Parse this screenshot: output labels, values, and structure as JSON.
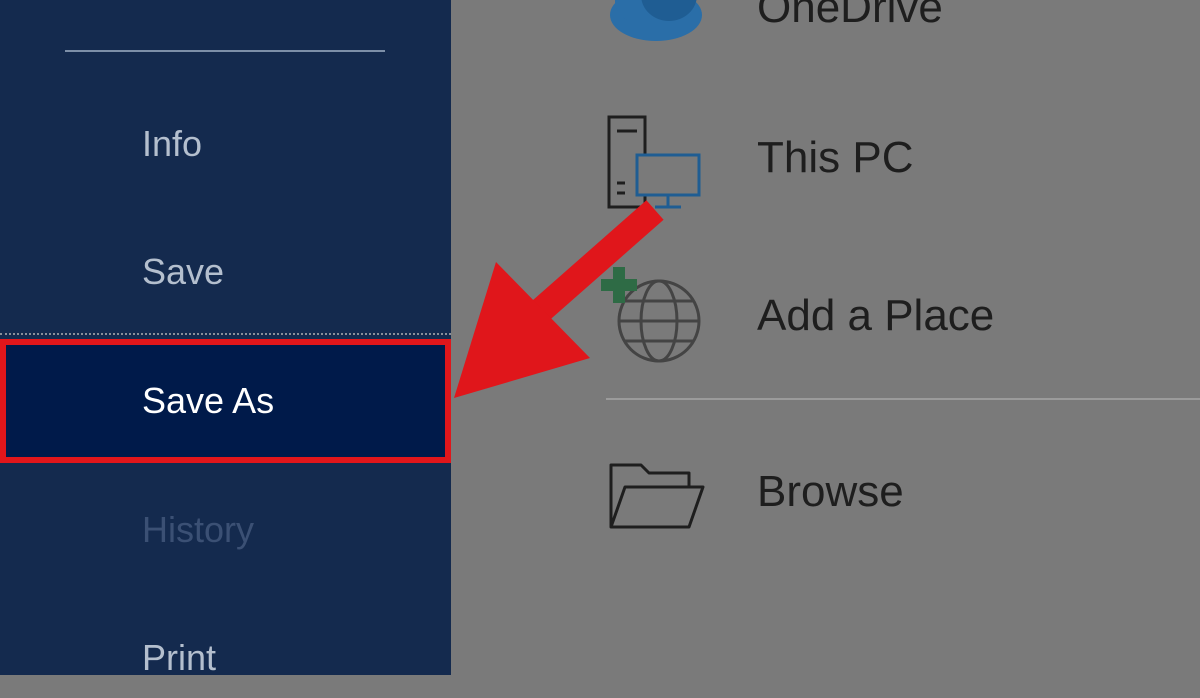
{
  "sidebar": {
    "items": [
      {
        "label": "Info",
        "state": "normal"
      },
      {
        "label": "Save",
        "state": "normal"
      },
      {
        "label": "Save As",
        "state": "selected"
      },
      {
        "label": "History",
        "state": "disabled"
      },
      {
        "label": "Print",
        "state": "normal"
      }
    ]
  },
  "locations": {
    "items": [
      {
        "label": "OneDrive",
        "icon": "onedrive-cloud-icon"
      },
      {
        "label": "This PC",
        "icon": "this-pc-icon"
      },
      {
        "label": "Add a Place",
        "icon": "add-place-globe-icon"
      },
      {
        "label": "Browse",
        "icon": "folder-open-icon"
      }
    ]
  },
  "annotation": {
    "arrow_color": "#e0161b",
    "highlight_color": "#e0161b"
  },
  "colors": {
    "sidebar_bg": "#142a4e",
    "selected_bg": "#001a4a",
    "content_bg": "#7a7a7a"
  }
}
